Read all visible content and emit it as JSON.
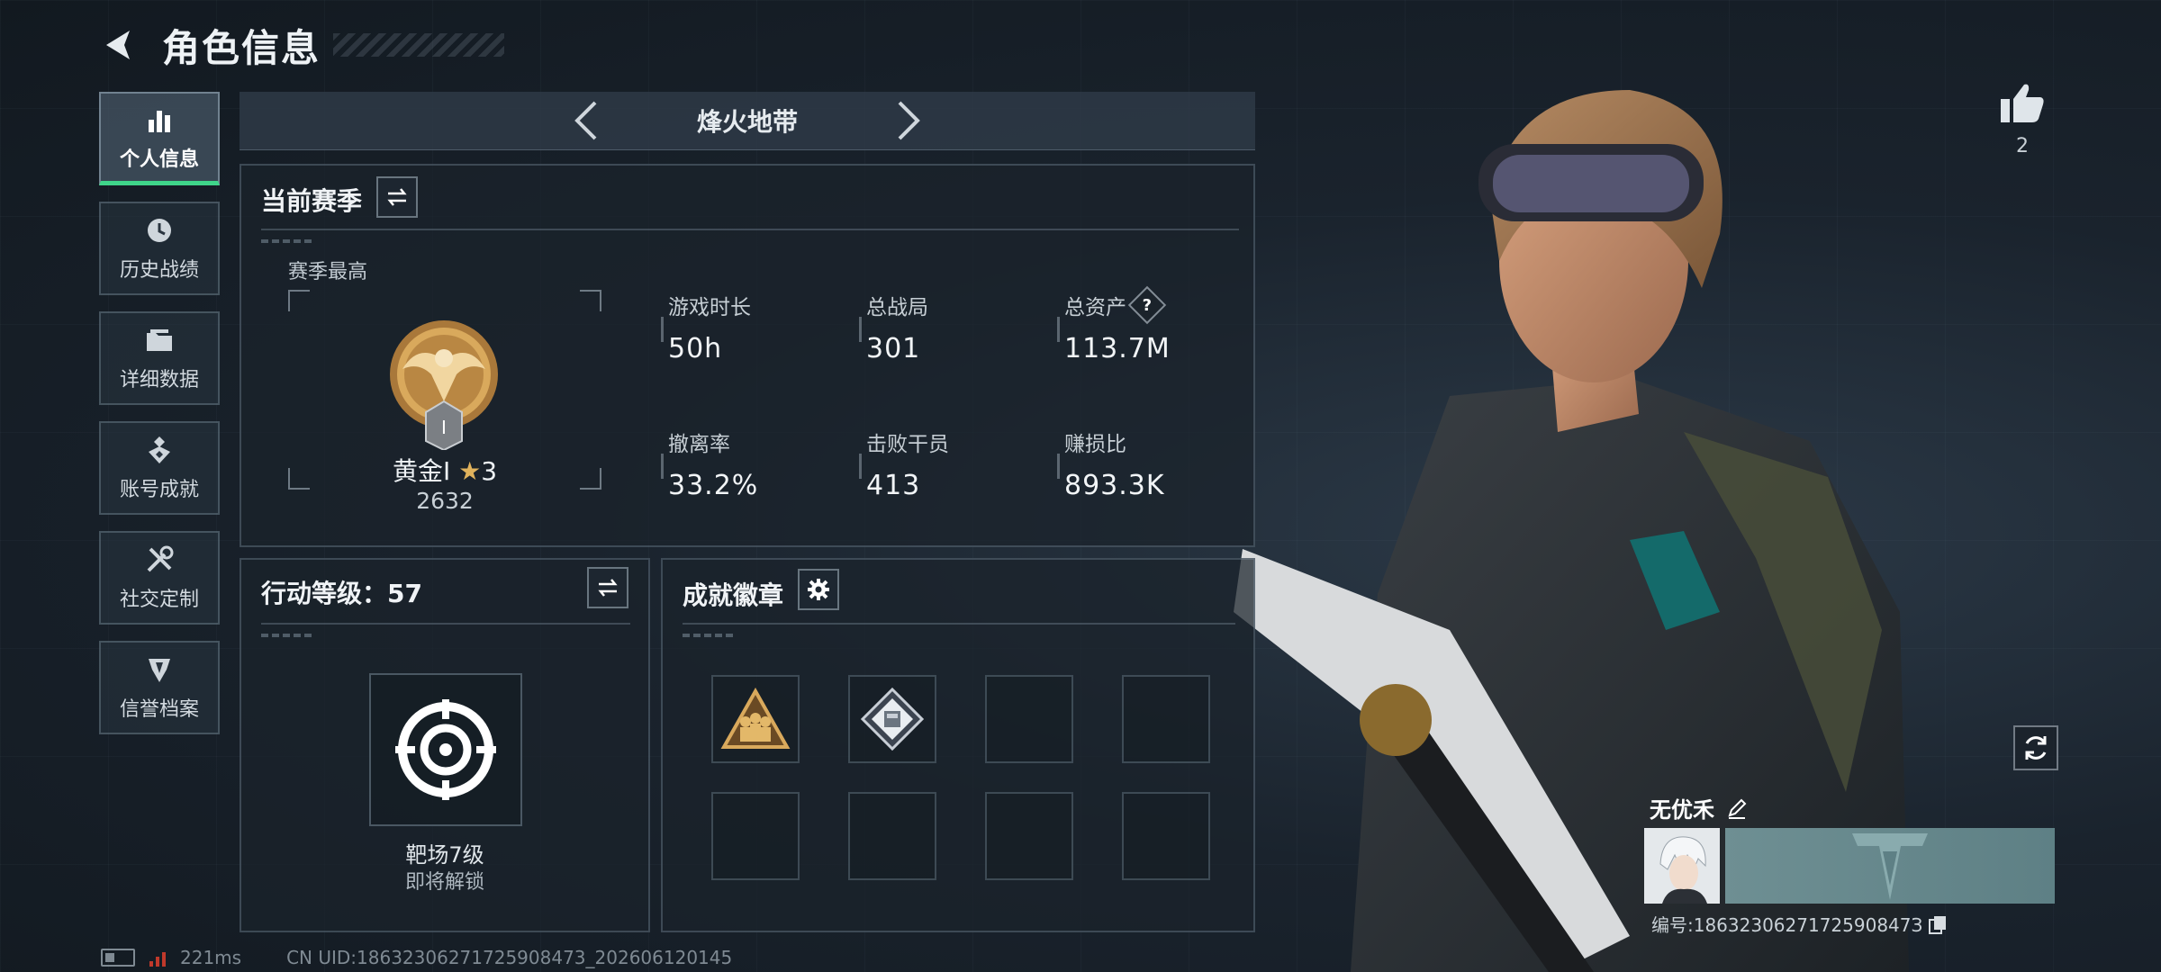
{
  "header": {
    "title": "角色信息"
  },
  "sidebar": {
    "items": [
      {
        "label": "个人信息",
        "icon": "bar-chart-icon",
        "active": true
      },
      {
        "label": "历史战绩",
        "icon": "history-clock-icon"
      },
      {
        "label": "详细数据",
        "icon": "folder-icon"
      },
      {
        "label": "账号成就",
        "icon": "achievement-icon"
      },
      {
        "label": "社交定制",
        "icon": "tools-icon"
      },
      {
        "label": "信誉档案",
        "icon": "reputation-icon"
      }
    ]
  },
  "mode": {
    "name": "烽火地带"
  },
  "season": {
    "title": "当前赛季",
    "best_label": "赛季最高",
    "rank_name": "黄金Ⅰ",
    "rank_stars": "3",
    "rank_score": "2632",
    "rank_badge_numeral": "Ⅰ",
    "stats": [
      {
        "label": "游戏时长",
        "value": "50h"
      },
      {
        "label": "总战局",
        "value": "301"
      },
      {
        "label": "总资产",
        "value": "113.7M",
        "help": "?"
      },
      {
        "label": "撤离率",
        "value": "33.2%"
      },
      {
        "label": "击败干员",
        "value": "413"
      },
      {
        "label": "赚损比",
        "value": "893.3K"
      }
    ]
  },
  "level": {
    "title": "行动等级：57",
    "card_name": "靶场7级",
    "card_status": "即将解锁"
  },
  "badges": {
    "title": "成就徽章",
    "slots": [
      "gold-squad-badge-icon",
      "diamond-crate-badge-icon",
      "",
      "",
      "",
      "",
      "",
      ""
    ]
  },
  "right": {
    "like_count": "2",
    "player_name": "无优禾",
    "uid_label": "编号:1863230627172590847З"
  },
  "status": {
    "ping": "221ms",
    "uid": "CN UID:18632306271725908473_202606120145"
  },
  "colors": {
    "accent": "#3fd58a",
    "gold": "#e0b25c",
    "panel_bg": "#1a222b"
  }
}
